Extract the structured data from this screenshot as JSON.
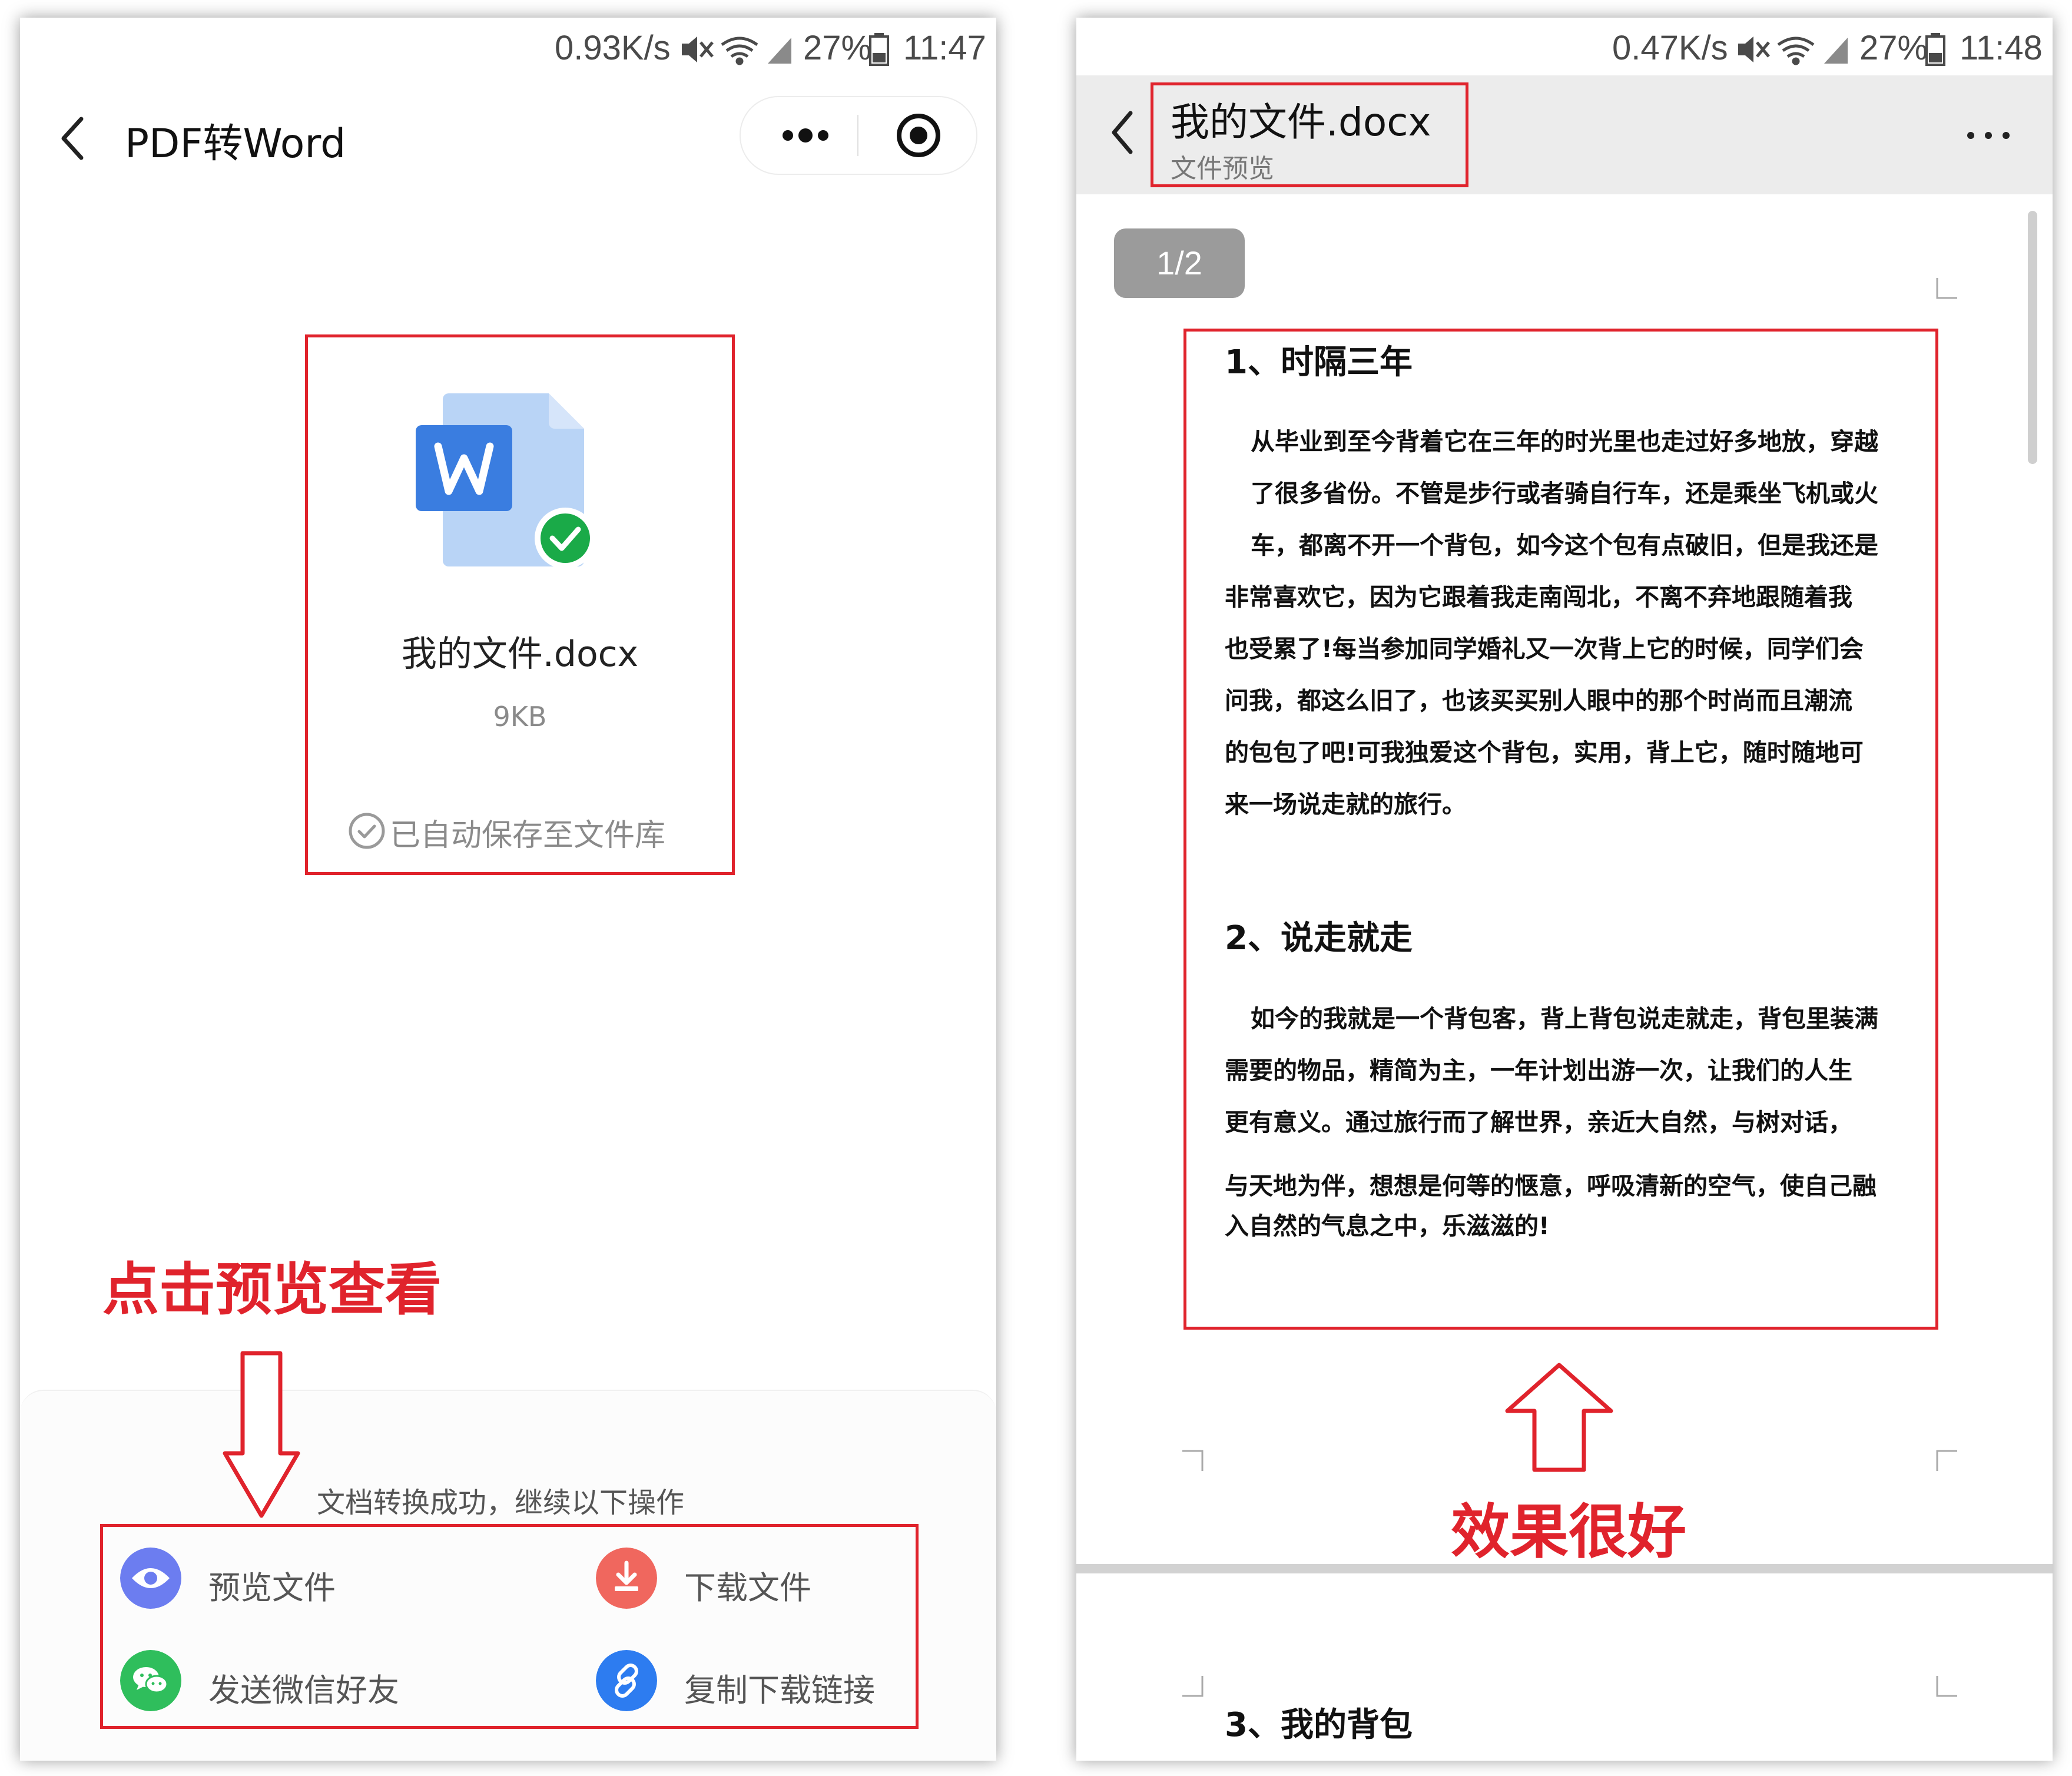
{
  "left_screen": {
    "status": {
      "speed": "0.93K/s",
      "battery": "27%",
      "time": "11:47"
    },
    "header": {
      "title": "PDF转Word"
    },
    "file_card": {
      "file_name": "我的文件.docx",
      "file_size": "9KB",
      "saved_note": "已自动保存至文件库"
    },
    "annotation": "点击预览查看",
    "panel": {
      "subtitle": "文档转换成功，继续以下操作",
      "actions": [
        {
          "label": "预览文件",
          "icon": "eye-icon",
          "color": "#6c7df0"
        },
        {
          "label": "下载文件",
          "icon": "download-icon",
          "color": "#f0675e"
        },
        {
          "label": "发送微信好友",
          "icon": "wechat-icon",
          "color": "#2fbe5c"
        },
        {
          "label": "复制下载链接",
          "icon": "link-icon",
          "color": "#2d7cf0"
        }
      ]
    }
  },
  "right_screen": {
    "status": {
      "speed": "0.47K/s",
      "battery": "27%",
      "time": "11:48"
    },
    "header": {
      "title": "我的文件.docx",
      "subtitle": "文件预览"
    },
    "page_indicator": "1/2",
    "document": {
      "section1_heading": "1、时隔三年",
      "section1_lines": [
        "从毕业到至今背着它在三年的时光里也走过好多地放，穿越",
        "了很多省份。不管是步行或者骑自行车，还是乘坐飞机或火",
        "车，都离不开一个背包，如今这个包有点破旧，但是我还是",
        "非常喜欢它，因为它跟着我走南闯北，不离不弃地跟随着我",
        "也受累了!每当参加同学婚礼又一次背上它的时候，同学们会",
        "问我，都这么旧了，也该买买别人眼中的那个时尚而且潮流",
        "的包包了吧!可我独爱这个背包，实用，背上它，随时随地可",
        "来一场说走就的旅行。"
      ],
      "section2_heading": "2、说走就走",
      "section2_lines": [
        "如今的我就是一个背包客，背上背包说走就走，背包里装满",
        "需要的物品，精简为主，一年计划出游一次，让我们的人生",
        "更有意义。通过旅行而了解世界，亲近大自然，与树对话，",
        "与天地为伴，想想是何等的惬意，呼吸清新的空气，使自己融",
        "入自然的气息之中，乐滋滋的!"
      ],
      "section3_heading": "3、我的背包"
    },
    "annotation": "效果很好"
  }
}
